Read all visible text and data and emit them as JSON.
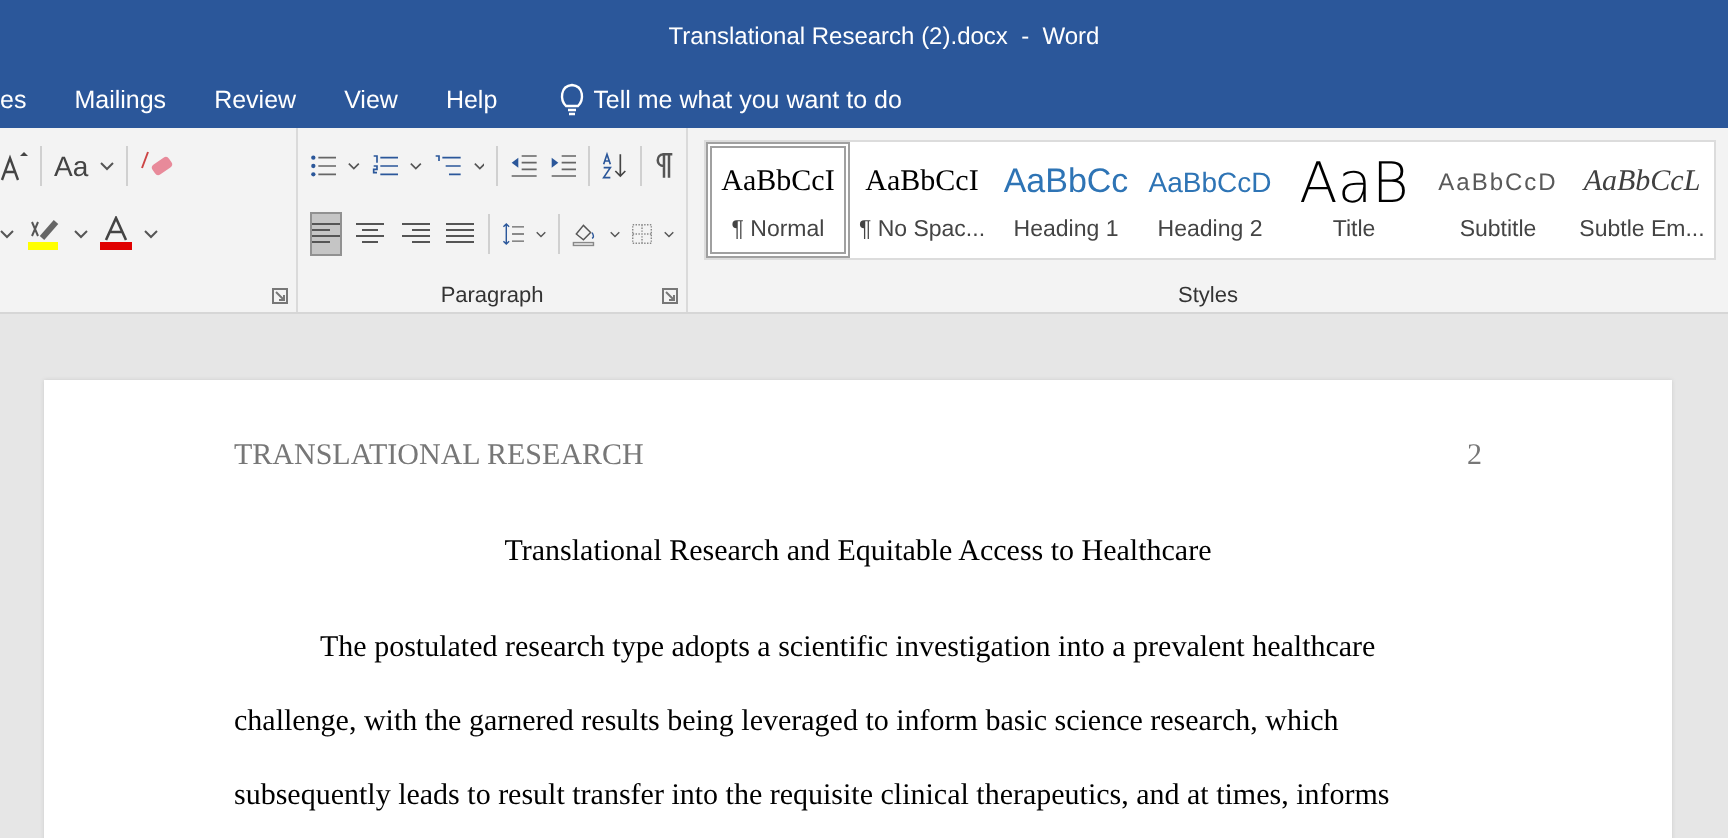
{
  "window": {
    "title": "Translational Research (2).docx  -  Word"
  },
  "menu_tabs": [
    {
      "label": "es"
    },
    {
      "label": "Mailings"
    },
    {
      "label": "Review"
    },
    {
      "label": "View"
    },
    {
      "label": "Help"
    }
  ],
  "tell_me": {
    "placeholder": "Tell me what you want to do"
  },
  "font_group": {
    "change_case": "Aa"
  },
  "paragraph_group": {
    "label": "Paragraph",
    "alignment": [
      {
        "kind": "left",
        "selected": true
      },
      {
        "kind": "center",
        "selected": false
      },
      {
        "kind": "right",
        "selected": false
      },
      {
        "kind": "justify",
        "selected": false
      }
    ]
  },
  "styles_group": {
    "label": "Styles",
    "styles": [
      {
        "kind": "serif",
        "sample": "AaBbCcI",
        "label": "¶ Normal",
        "selected": true
      },
      {
        "kind": "serif",
        "sample": "AaBbCcI",
        "label": "¶ No Spac...",
        "selected": false
      },
      {
        "kind": "heading1",
        "sample": "AaBbCc",
        "label": "Heading 1",
        "selected": false
      },
      {
        "kind": "heading2",
        "sample": "AaBbCcD",
        "label": "Heading 2",
        "selected": false
      },
      {
        "kind": "title",
        "sample": "AaB",
        "label": "Title",
        "selected": false
      },
      {
        "kind": "subtitle",
        "sample": "AaBbCcD",
        "label": "Subtitle",
        "selected": false
      },
      {
        "kind": "emphasis",
        "sample": "AaBbCcL",
        "label": "Subtle Em...",
        "selected": false
      }
    ]
  },
  "document": {
    "header": "TRANSLATIONAL RESEARCH",
    "page_number": "2",
    "title": "Translational Research and Equitable Access to Healthcare",
    "body_lines": [
      "The postulated research type adopts a scientific investigation into a prevalent healthcare",
      "challenge, with the garnered results being leveraged to inform basic science research, which",
      "subsequently leads to result transfer into the requisite clinical therapeutics, and at times, informs"
    ]
  }
}
